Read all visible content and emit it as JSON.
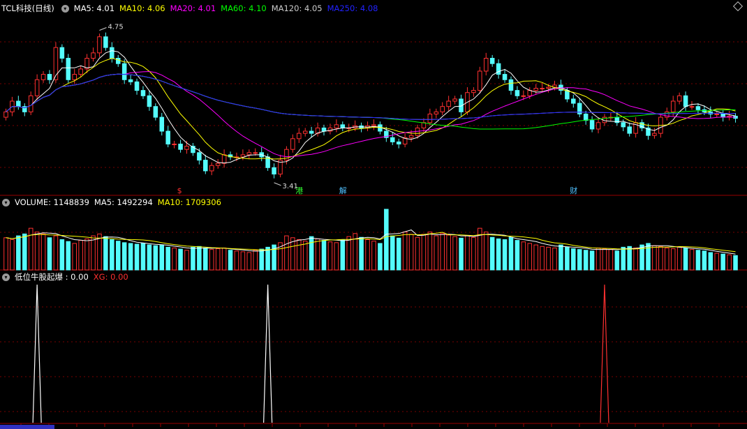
{
  "header": {
    "title": "TCL科技(日线)",
    "ma": [
      {
        "label": "MA5: 4.01",
        "color": "#ffffff"
      },
      {
        "label": "MA10: 4.06",
        "color": "#ffff00"
      },
      {
        "label": "MA20: 4.01",
        "color": "#ff00ff"
      },
      {
        "label": "MA60: 4.10",
        "color": "#00ff00"
      },
      {
        "label": "MA120: 4.05",
        "color": "#cccccc"
      },
      {
        "label": "MA250: 4.08",
        "color": "#2222ff"
      }
    ]
  },
  "price_panel": {
    "high_label": "4.75",
    "low_label": "3.41",
    "event_markers": [
      {
        "text": "$",
        "color": "#ff3030"
      },
      {
        "text": "港",
        "color": "#30ff30"
      },
      {
        "text": "解",
        "color": "#50c0ff"
      },
      {
        "text": "财",
        "color": "#50c0ff"
      }
    ]
  },
  "volume_header": {
    "items": [
      {
        "label": "VOLUME: 1148839",
        "color": "#ffffff"
      },
      {
        "label": "MA5: 1492294",
        "color": "#ffffff"
      },
      {
        "label": "MA10: 1709306",
        "color": "#ffff00"
      }
    ]
  },
  "indicator_header": {
    "items": [
      {
        "label": "低位牛股起爆 : 0.00",
        "color": "#ffffff"
      },
      {
        "label": "XG: 0.00",
        "color": "#ff3030"
      }
    ]
  },
  "colors": {
    "up": "#ff3030",
    "down": "#54fcfc",
    "grid": "#7a0000"
  },
  "chart_data": {
    "type": "candlestick",
    "ylim": [
      3.3,
      4.9
    ],
    "close": [
      4.0,
      4.1,
      4.05,
      4.0,
      4.15,
      4.3,
      4.35,
      4.3,
      4.6,
      4.5,
      4.3,
      4.35,
      4.4,
      4.5,
      4.55,
      4.7,
      4.6,
      4.5,
      4.45,
      4.3,
      4.28,
      4.2,
      4.15,
      4.05,
      3.95,
      3.82,
      3.7,
      3.7,
      3.65,
      3.68,
      3.62,
      3.55,
      3.45,
      3.5,
      3.52,
      3.6,
      3.58,
      3.58,
      3.6,
      3.62,
      3.62,
      3.58,
      3.48,
      3.42,
      3.55,
      3.65,
      3.75,
      3.8,
      3.82,
      3.8,
      3.85,
      3.82,
      3.85,
      3.88,
      3.85,
      3.85,
      3.87,
      3.85,
      3.87,
      3.88,
      3.82,
      3.76,
      3.72,
      3.7,
      3.76,
      3.78,
      3.85,
      3.9,
      3.98,
      4.0,
      4.05,
      4.1,
      4.12,
      4.0,
      4.18,
      4.2,
      4.38,
      4.5,
      4.45,
      4.35,
      4.3,
      4.2,
      4.15,
      4.15,
      4.2,
      4.22,
      4.22,
      4.23,
      4.25,
      4.2,
      4.12,
      4.08,
      3.98,
      3.92,
      3.84,
      3.9,
      3.95,
      3.95,
      3.9,
      3.86,
      3.8,
      3.9,
      3.85,
      3.78,
      3.8,
      3.95,
      4.0,
      4.1,
      4.15,
      4.05,
      4.05,
      4.02,
      4.0,
      3.98,
      3.98,
      3.95,
      3.96,
      3.94
    ],
    "volume": [
      85,
      80,
      90,
      95,
      110,
      100,
      95,
      85,
      90,
      80,
      75,
      70,
      78,
      82,
      90,
      95,
      88,
      80,
      76,
      72,
      70,
      68,
      70,
      66,
      64,
      66,
      60,
      58,
      55,
      52,
      60,
      62,
      58,
      54,
      56,
      58,
      52,
      50,
      48,
      46,
      52,
      55,
      60,
      66,
      72,
      90,
      85,
      80,
      76,
      88,
      82,
      78,
      74,
      72,
      80,
      88,
      96,
      86,
      80,
      76,
      70,
      160,
      90,
      84,
      100,
      94,
      86,
      94,
      100,
      90,
      96,
      92,
      88,
      84,
      90,
      86,
      110,
      100,
      86,
      82,
      80,
      86,
      78,
      74,
      70,
      66,
      62,
      60,
      58,
      66,
      60,
      56,
      54,
      52,
      50,
      58,
      56,
      54,
      50,
      60,
      62,
      58,
      66,
      70,
      64,
      62,
      58,
      56,
      60,
      58,
      54,
      52,
      50,
      46,
      44,
      42,
      40,
      38
    ],
    "vol_max": 160,
    "ind_a_indexes": [
      5,
      42
    ],
    "ind_b_indexes": [
      96
    ]
  }
}
